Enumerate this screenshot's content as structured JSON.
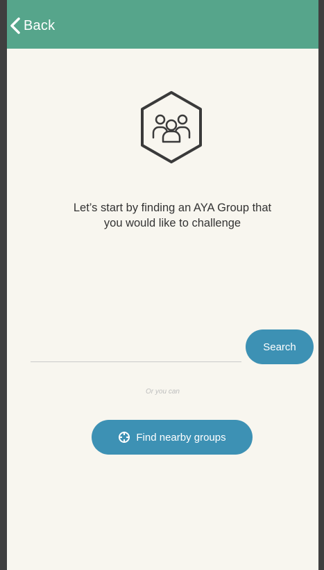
{
  "header": {
    "back_label": "Back",
    "back_icon": "chevron-left-icon",
    "background": "#56a58b"
  },
  "main": {
    "group_icon": "group-hexagon-icon",
    "prompt_line1": "Let’s start by finding an AYA Group that",
    "prompt_line2": "you would like to challenge",
    "search_value": "",
    "search_placeholder": "",
    "search_button_label": "Search",
    "or_text": "Or you can",
    "nearby_button_label": "Find nearby groups",
    "nearby_icon": "crosshair-icon",
    "button_color": "#3d91b4"
  }
}
